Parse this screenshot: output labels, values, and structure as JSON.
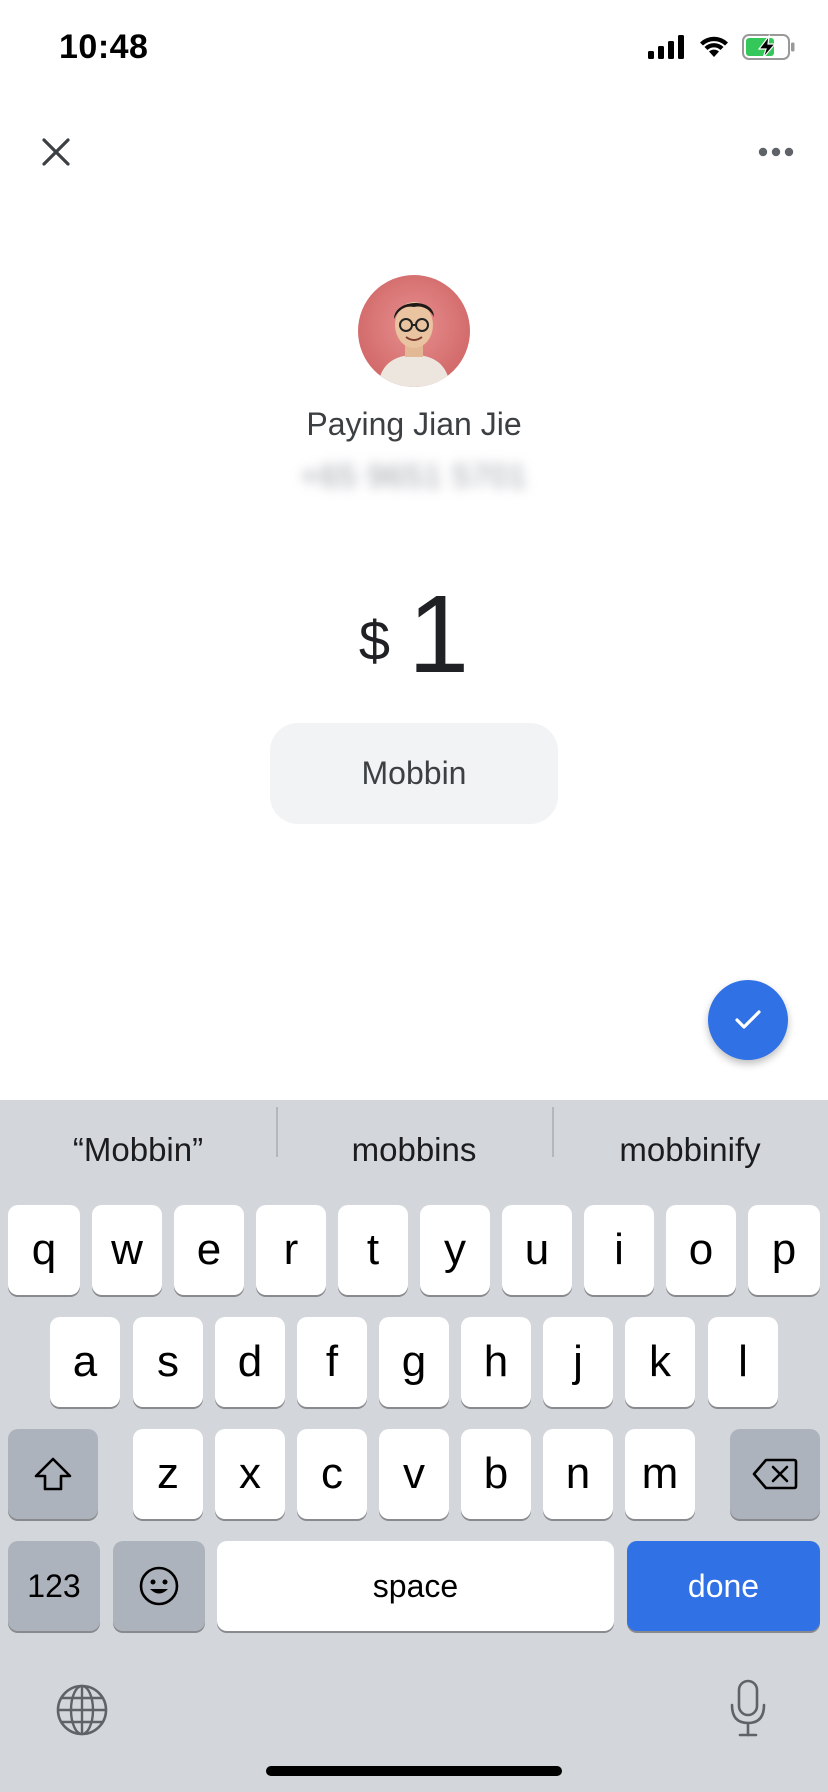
{
  "status_bar": {
    "time": "10:48"
  },
  "payee": {
    "prefix": "Paying",
    "name": "Jian Jie",
    "display": "Paying Jian Jie",
    "phone": "+65 9651 5701"
  },
  "amount": {
    "currency": "$",
    "value": "1"
  },
  "note": {
    "value": "Mobbin"
  },
  "keyboard": {
    "suggestions": [
      "“Mobbin”",
      "mobbins",
      "mobbinify"
    ],
    "row1": [
      "q",
      "w",
      "e",
      "r",
      "t",
      "y",
      "u",
      "i",
      "o",
      "p"
    ],
    "row2": [
      "a",
      "s",
      "d",
      "f",
      "g",
      "h",
      "j",
      "k",
      "l"
    ],
    "row3": [
      "z",
      "x",
      "c",
      "v",
      "b",
      "n",
      "m"
    ],
    "numbers_label": "123",
    "space_label": "space",
    "done_label": "done"
  },
  "colors": {
    "accent": "#3171e6",
    "keyboard_bg": "#d3d6db"
  },
  "icons": [
    "close-icon",
    "more-icon",
    "check-icon",
    "shift-icon",
    "backspace-icon",
    "emoji-icon",
    "globe-icon",
    "microphone-icon"
  ]
}
